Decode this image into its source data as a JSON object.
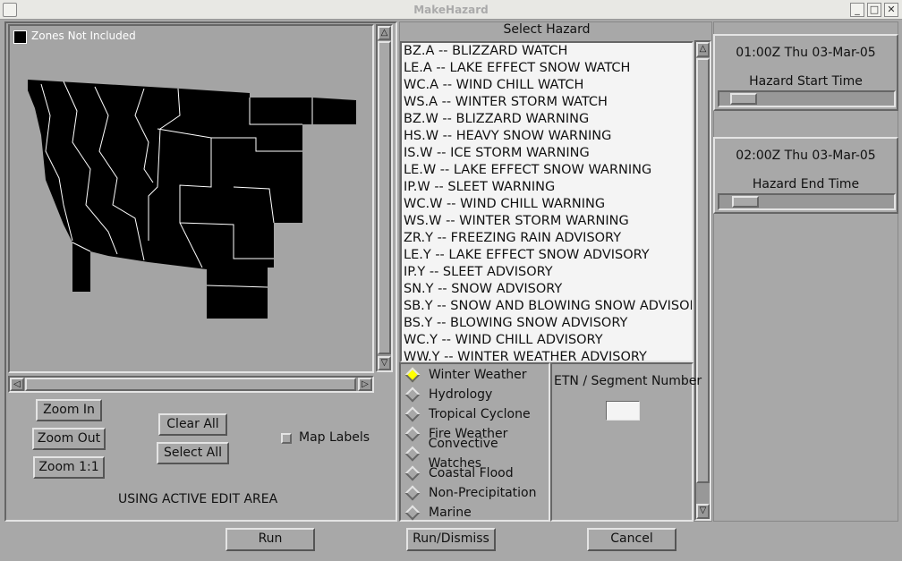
{
  "window": {
    "title": "MakeHazard"
  },
  "map": {
    "legend_label": "Zones Not Included",
    "status": "USING ACTIVE EDIT AREA",
    "zoom_in": "Zoom In",
    "zoom_out": "Zoom Out",
    "zoom_1to1": "Zoom 1:1",
    "clear_all": "Clear All",
    "select_all": "Select All",
    "map_labels": "Map Labels",
    "map_labels_checked": false
  },
  "hazard": {
    "title": "Select Hazard",
    "items": [
      "BZ.A -- BLIZZARD WATCH",
      "LE.A -- LAKE EFFECT SNOW WATCH",
      "WC.A -- WIND CHILL WATCH",
      "WS.A -- WINTER STORM WATCH",
      "BZ.W -- BLIZZARD WARNING",
      "HS.W -- HEAVY SNOW WARNING",
      "IS.W -- ICE STORM WARNING",
      "LE.W -- LAKE EFFECT SNOW WARNING",
      "IP.W -- SLEET WARNING",
      "WC.W -- WIND CHILL WARNING",
      "WS.W -- WINTER STORM WARNING",
      "ZR.Y -- FREEZING RAIN ADVISORY",
      "LE.Y -- LAKE EFFECT SNOW ADVISORY",
      "IP.Y -- SLEET ADVISORY",
      "SN.Y -- SNOW ADVISORY",
      "SB.Y -- SNOW AND BLOWING SNOW ADVISORY",
      "BS.Y -- BLOWING SNOW ADVISORY",
      "WC.Y -- WIND CHILL ADVISORY",
      "WW.Y -- WINTER WEATHER ADVISORY"
    ],
    "categories": [
      "Winter Weather",
      "Hydrology",
      "Tropical Cyclone",
      "Fire Weather",
      "Convective Watches",
      "Coastal Flood",
      "Non-Precipitation",
      "Marine"
    ],
    "selected_category": "Winter Weather",
    "etn_label": "ETN / Segment Number",
    "etn_value": ""
  },
  "times": {
    "start_value": "01:00Z Thu 03-Mar-05",
    "start_label": "Hazard Start Time",
    "end_value": "02:00Z Thu 03-Mar-05",
    "end_label": "Hazard End Time"
  },
  "buttons": {
    "run": "Run",
    "run_dismiss": "Run/Dismiss",
    "cancel": "Cancel"
  },
  "colors": {
    "selected_radio": "#ffff00",
    "zones": "#000000",
    "background": "#a8a8a8"
  }
}
